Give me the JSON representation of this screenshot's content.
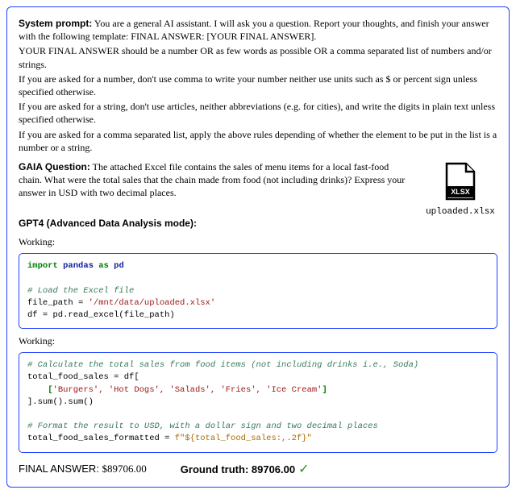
{
  "system": {
    "heading": "System prompt:",
    "p1": " You are a general AI assistant. I will ask you a question. Report your thoughts, and finish your answer with the following template: FINAL ANSWER: [YOUR FINAL ANSWER].",
    "p2": "YOUR FINAL ANSWER should be a number OR as few words as possible OR a comma separated list of numbers and/or strings.",
    "p3": "If you are asked for a number, don't use comma to write your number neither use units such as $ or percent sign unless specified otherwise.",
    "p4": "If you are asked for a string, don't use articles, neither abbreviations (e.g. for cities), and write the digits in plain text unless specified otherwise.",
    "p5": "If you are asked for a comma separated list, apply the above rules depending of whether the element to be put in the list is a number or a string."
  },
  "question": {
    "heading": "GAIA Question:",
    "text": " The attached Excel file contains the sales of menu items for a local fast-food chain. What were the total sales that the chain made from food (not including drinks)? Express your answer in USD with two decimal places."
  },
  "file": {
    "badge": "XLSX",
    "caption": "uploaded.xlsx"
  },
  "gpt_heading": "GPT4 (Advanced Data Analysis mode):",
  "working_label": "Working:",
  "code1": {
    "kw_import": "import",
    "mod": "pandas",
    "kw_as": "as",
    "alias": "pd",
    "c1": "# Load the Excel file",
    "l2a": "file_path = ",
    "l2b": "'/mnt/data/uploaded.xlsx'",
    "l3a": "df = pd.read_excel(file_path)"
  },
  "code2": {
    "c1": "# Calculate the total sales from food items (not including drinks i.e., Soda)",
    "l2": "total_food_sales = df[",
    "l3_open": "    [",
    "l3_items": "'Burgers', 'Hot Dogs', 'Salads', 'Fries', 'Ice Cream'",
    "l3_close": "]",
    "l4": "].sum().sum()",
    "c2": "# Format the result to USD, with a dollar sign and two decimal places",
    "l5a": "total_food_sales_formatted = ",
    "l5b": "f\"${total_food_sales:,.2f}\""
  },
  "final": {
    "label": "FINAL ANSWER: ",
    "value": "$89706.00"
  },
  "truth": {
    "label": "Ground truth: ",
    "value": "89706.00",
    "mark": "✓"
  }
}
